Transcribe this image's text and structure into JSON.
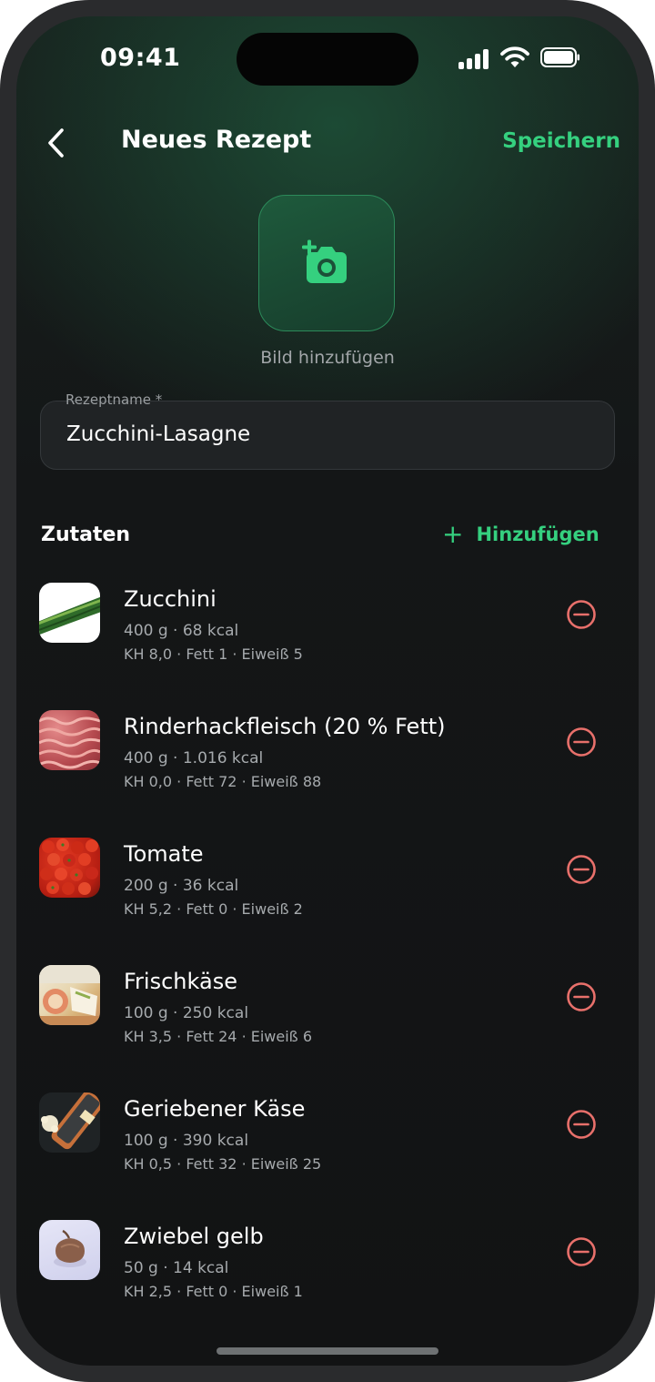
{
  "status_bar": {
    "time": "09:41"
  },
  "header": {
    "title": "Neues Rezept",
    "save_label": "Speichern"
  },
  "photo": {
    "label": "Bild hinzufügen"
  },
  "recipe_name": {
    "label": "Rezeptname *",
    "value": "Zucchini-Lasagne"
  },
  "ingredients_section": {
    "title": "Zutaten",
    "add_label": "Hinzufügen"
  },
  "ingredients": [
    {
      "name": "Zucchini",
      "amount": "400 g · 68 kcal",
      "macros": "KH 8,0 · Fett 1 · Eiweiß 5",
      "image": "zucchini"
    },
    {
      "name": "Rinderhackfleisch (20 % Fett)",
      "amount": "400 g · 1.016 kcal",
      "macros": "KH 0,0 · Fett 72 · Eiweiß 88",
      "image": "minced-beef"
    },
    {
      "name": "Tomate",
      "amount": "200 g · 36 kcal",
      "macros": "KH 5,2 · Fett 0 · Eiweiß 2",
      "image": "tomatoes"
    },
    {
      "name": "Frischkäse",
      "amount": "100 g · 250 kcal",
      "macros": "KH 3,5 · Fett 24 · Eiweiß 6",
      "image": "cream-cheese"
    },
    {
      "name": "Geriebener Käse",
      "amount": "100 g · 390 kcal",
      "macros": "KH 0,5 · Fett 32 · Eiweiß 25",
      "image": "grated-cheese"
    },
    {
      "name": "Zwiebel gelb",
      "amount": "50 g · 14 kcal",
      "macros": "KH 2,5 · Fett 0 · Eiweiß 1",
      "image": "yellow-onion"
    }
  ],
  "colors": {
    "accent": "#35d07f",
    "remove": "#e8706b",
    "background": "#131516"
  }
}
